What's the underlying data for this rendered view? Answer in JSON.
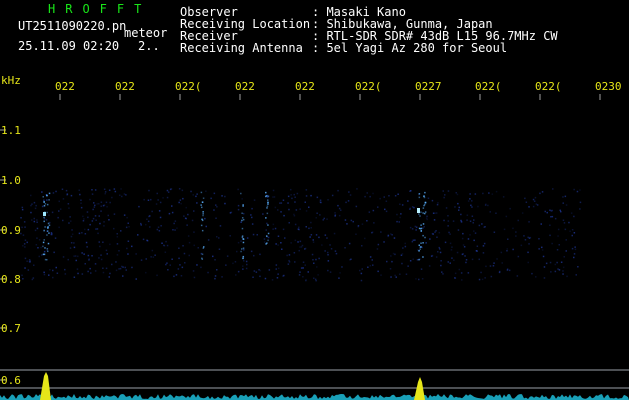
{
  "header": {
    "brand": "HROFFT",
    "filename": "UT2511090220.pn",
    "tag": "meteor",
    "datetime": "25.11.09 02:20",
    "counter": "2..",
    "info_labels": [
      "Observer",
      "Receiving Location",
      "Receiver",
      "Receiving Antenna"
    ],
    "info_values": [
      ": Masaki Kano",
      ": Shibukawa, Gunma, Japan",
      ": RTL-SDR SDR# 43dB L15 96.7MHz CW",
      ": 5el Yagi Az 280 for Seoul"
    ]
  },
  "axis": {
    "unit": "kHz",
    "y_labels": [
      "1.1",
      "1.0",
      "0.9",
      "0.8",
      "0.7",
      "0.6"
    ],
    "x_labels": [
      "022",
      "022",
      "022(",
      "022",
      "022",
      "022(",
      "0227",
      "022(",
      "022(",
      "0230"
    ]
  },
  "colors": {
    "accent_green": "#19e619",
    "label_yellow": "#e6e619",
    "grid": "#a0a0a0"
  }
}
